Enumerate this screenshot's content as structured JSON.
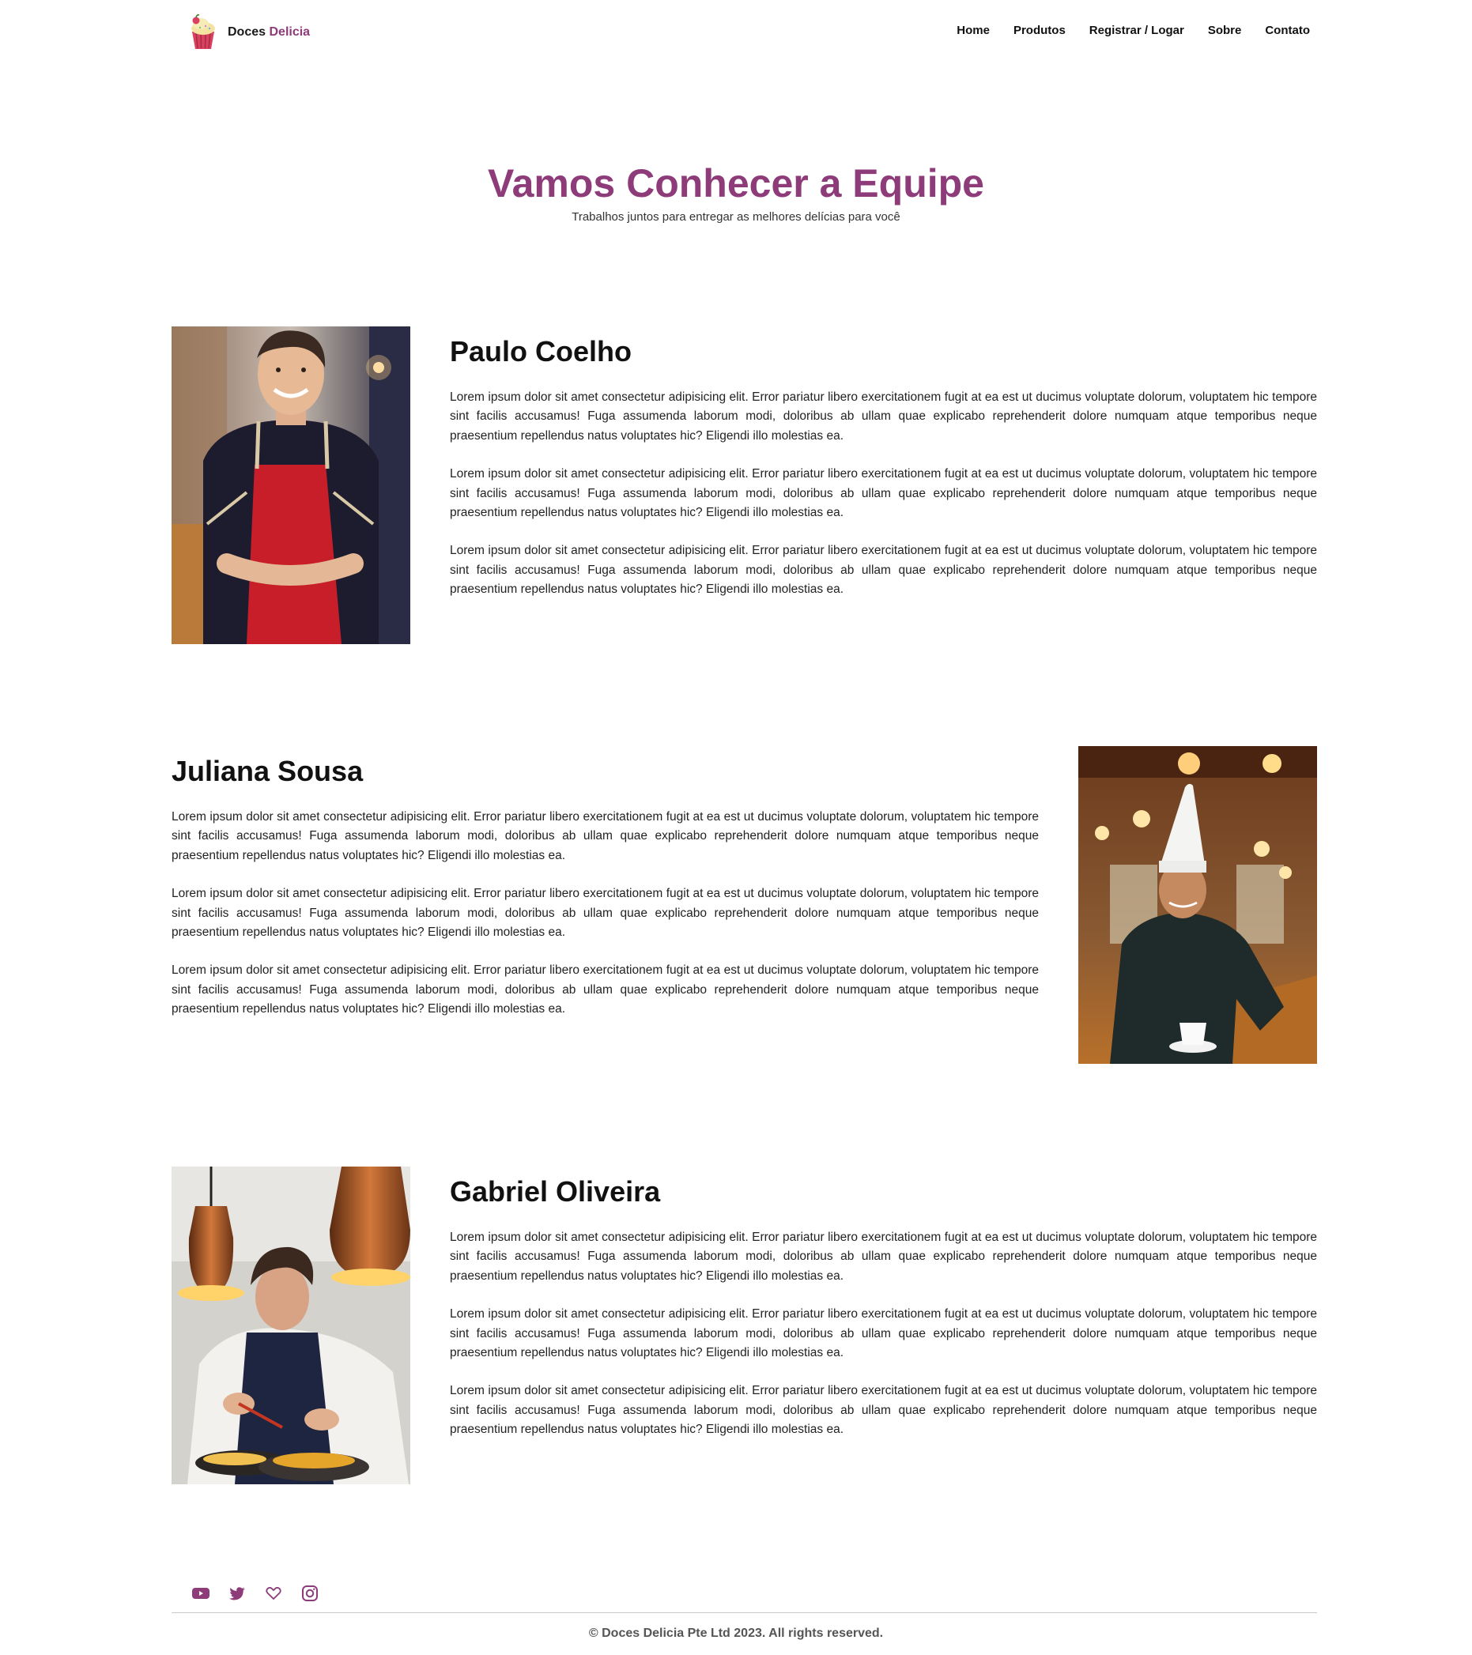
{
  "header": {
    "brand_name": "Doces",
    "brand_accent": "Delicia",
    "logo_icon": "cupcake-icon",
    "nav": [
      {
        "label": "Home"
      },
      {
        "label": "Produtos"
      },
      {
        "label": "Registrar / Logar"
      },
      {
        "label": "Sobre"
      },
      {
        "label": "Contato"
      }
    ]
  },
  "hero": {
    "title": "Vamos Conhecer a Equipe",
    "subtitle": "Trabalhos juntos para entregar as melhores delícias para você"
  },
  "team": [
    {
      "name": "Paulo Coelho",
      "photo": "chef-red-apron-photo",
      "paragraphs": [
        "Lorem ipsum dolor sit amet consectetur adipisicing elit. Error pariatur libero exercitationem fugit at ea est ut ducimus voluptate dolorum, voluptatem hic tempore sint facilis accusamus! Fuga assumenda laborum modi, doloribus ab ullam quae explicabo reprehenderit dolore numquam atque temporibus neque praesentium repellendus natus voluptates hic? Eligendi illo molestias ea.",
        "Lorem ipsum dolor sit amet consectetur adipisicing elit. Error pariatur libero exercitationem fugit at ea est ut ducimus voluptate dolorum, voluptatem hic tempore sint facilis accusamus! Fuga assumenda laborum modi, doloribus ab ullam quae explicabo reprehenderit dolore numquam atque temporibus neque praesentium repellendus natus voluptates hic? Eligendi illo molestias ea.",
        "Lorem ipsum dolor sit amet consectetur adipisicing elit. Error pariatur libero exercitationem fugit at ea est ut ducimus voluptate dolorum, voluptatem hic tempore sint facilis accusamus! Fuga assumenda laborum modi, doloribus ab ullam quae explicabo reprehenderit dolore numquam atque temporibus neque praesentium repellendus natus voluptates hic? Eligendi illo molestias ea."
      ]
    },
    {
      "name": "Juliana Sousa",
      "photo": "chef-white-hat-photo",
      "paragraphs": [
        "Lorem ipsum dolor sit amet consectetur adipisicing elit. Error pariatur libero exercitationem fugit at ea est ut ducimus voluptate dolorum, voluptatem hic tempore sint facilis accusamus! Fuga assumenda laborum modi, doloribus ab ullam quae explicabo reprehenderit dolore numquam atque temporibus neque praesentium repellendus natus voluptates hic? Eligendi illo molestias ea.",
        "Lorem ipsum dolor sit amet consectetur adipisicing elit. Error pariatur libero exercitationem fugit at ea est ut ducimus voluptate dolorum, voluptatem hic tempore sint facilis accusamus! Fuga assumenda laborum modi, doloribus ab ullam quae explicabo reprehenderit dolore numquam atque temporibus neque praesentium repellendus natus voluptates hic? Eligendi illo molestias ea.",
        "Lorem ipsum dolor sit amet consectetur adipisicing elit. Error pariatur libero exercitationem fugit at ea est ut ducimus voluptate dolorum, voluptatem hic tempore sint facilis accusamus! Fuga assumenda laborum modi, doloribus ab ullam quae explicabo reprehenderit dolore numquam atque temporibus neque praesentium repellendus natus voluptates hic? Eligendi illo molestias ea."
      ]
    },
    {
      "name": "Gabriel Oliveira",
      "photo": "chef-copper-lamps-photo",
      "paragraphs": [
        "Lorem ipsum dolor sit amet consectetur adipisicing elit. Error pariatur libero exercitationem fugit at ea est ut ducimus voluptate dolorum, voluptatem hic tempore sint facilis accusamus! Fuga assumenda laborum modi, doloribus ab ullam quae explicabo reprehenderit dolore numquam atque temporibus neque praesentium repellendus natus voluptates hic? Eligendi illo molestias ea.",
        "Lorem ipsum dolor sit amet consectetur adipisicing elit. Error pariatur libero exercitationem fugit at ea est ut ducimus voluptate dolorum, voluptatem hic tempore sint facilis accusamus! Fuga assumenda laborum modi, doloribus ab ullam quae explicabo reprehenderit dolore numquam atque temporibus neque praesentium repellendus natus voluptates hic? Eligendi illo molestias ea.",
        "Lorem ipsum dolor sit amet consectetur adipisicing elit. Error pariatur libero exercitationem fugit at ea est ut ducimus voluptate dolorum, voluptatem hic tempore sint facilis accusamus! Fuga assumenda laborum modi, doloribus ab ullam quae explicabo reprehenderit dolore numquam atque temporibus neque praesentium repellendus natus voluptates hic? Eligendi illo molestias ea."
      ]
    }
  ],
  "footer": {
    "social_icons": [
      "youtube-icon",
      "twitter-icon",
      "heart-icon",
      "instagram-icon"
    ],
    "copyright": "© Doces Delicia Pte Ltd 2023. All rights reserved."
  },
  "colors": {
    "accent": "#8e3b7a",
    "text": "#111111",
    "footer_text": "#555555"
  }
}
